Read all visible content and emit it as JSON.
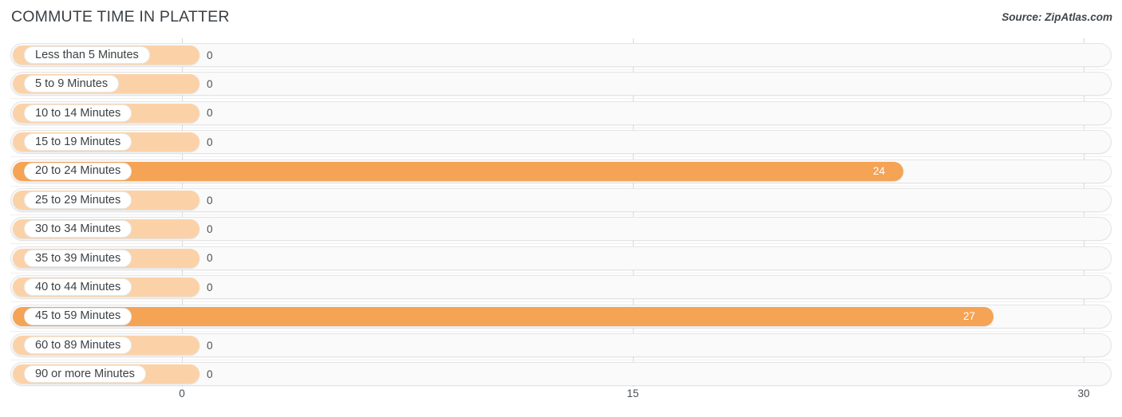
{
  "header": {
    "title": "COMMUTE TIME IN PLATTER",
    "source": "Source: ZipAtlas.com"
  },
  "colors": {
    "bar_value": "#f5a354",
    "bar_zero": "#fbd2a8",
    "track": "#fafafa",
    "gridline": "#d8d8d8",
    "text": "#4a4f54"
  },
  "chart_data": {
    "type": "bar",
    "orientation": "horizontal",
    "title": "COMMUTE TIME IN PLATTER",
    "xlabel": "",
    "ylabel": "",
    "xlim": [
      0,
      30
    ],
    "ticks": [
      "0",
      "15",
      "30"
    ],
    "tick_values": [
      0,
      15,
      30
    ],
    "grid": true,
    "legend": false,
    "categories": [
      "Less than 5 Minutes",
      "5 to 9 Minutes",
      "10 to 14 Minutes",
      "15 to 19 Minutes",
      "20 to 24 Minutes",
      "25 to 29 Minutes",
      "30 to 34 Minutes",
      "35 to 39 Minutes",
      "40 to 44 Minutes",
      "45 to 59 Minutes",
      "60 to 89 Minutes",
      "90 or more Minutes"
    ],
    "values": [
      0,
      0,
      0,
      0,
      24,
      0,
      0,
      0,
      0,
      27,
      0,
      0
    ],
    "labels": [
      "0",
      "0",
      "0",
      "0",
      "24",
      "0",
      "0",
      "0",
      "0",
      "27",
      "0",
      "0"
    ]
  }
}
